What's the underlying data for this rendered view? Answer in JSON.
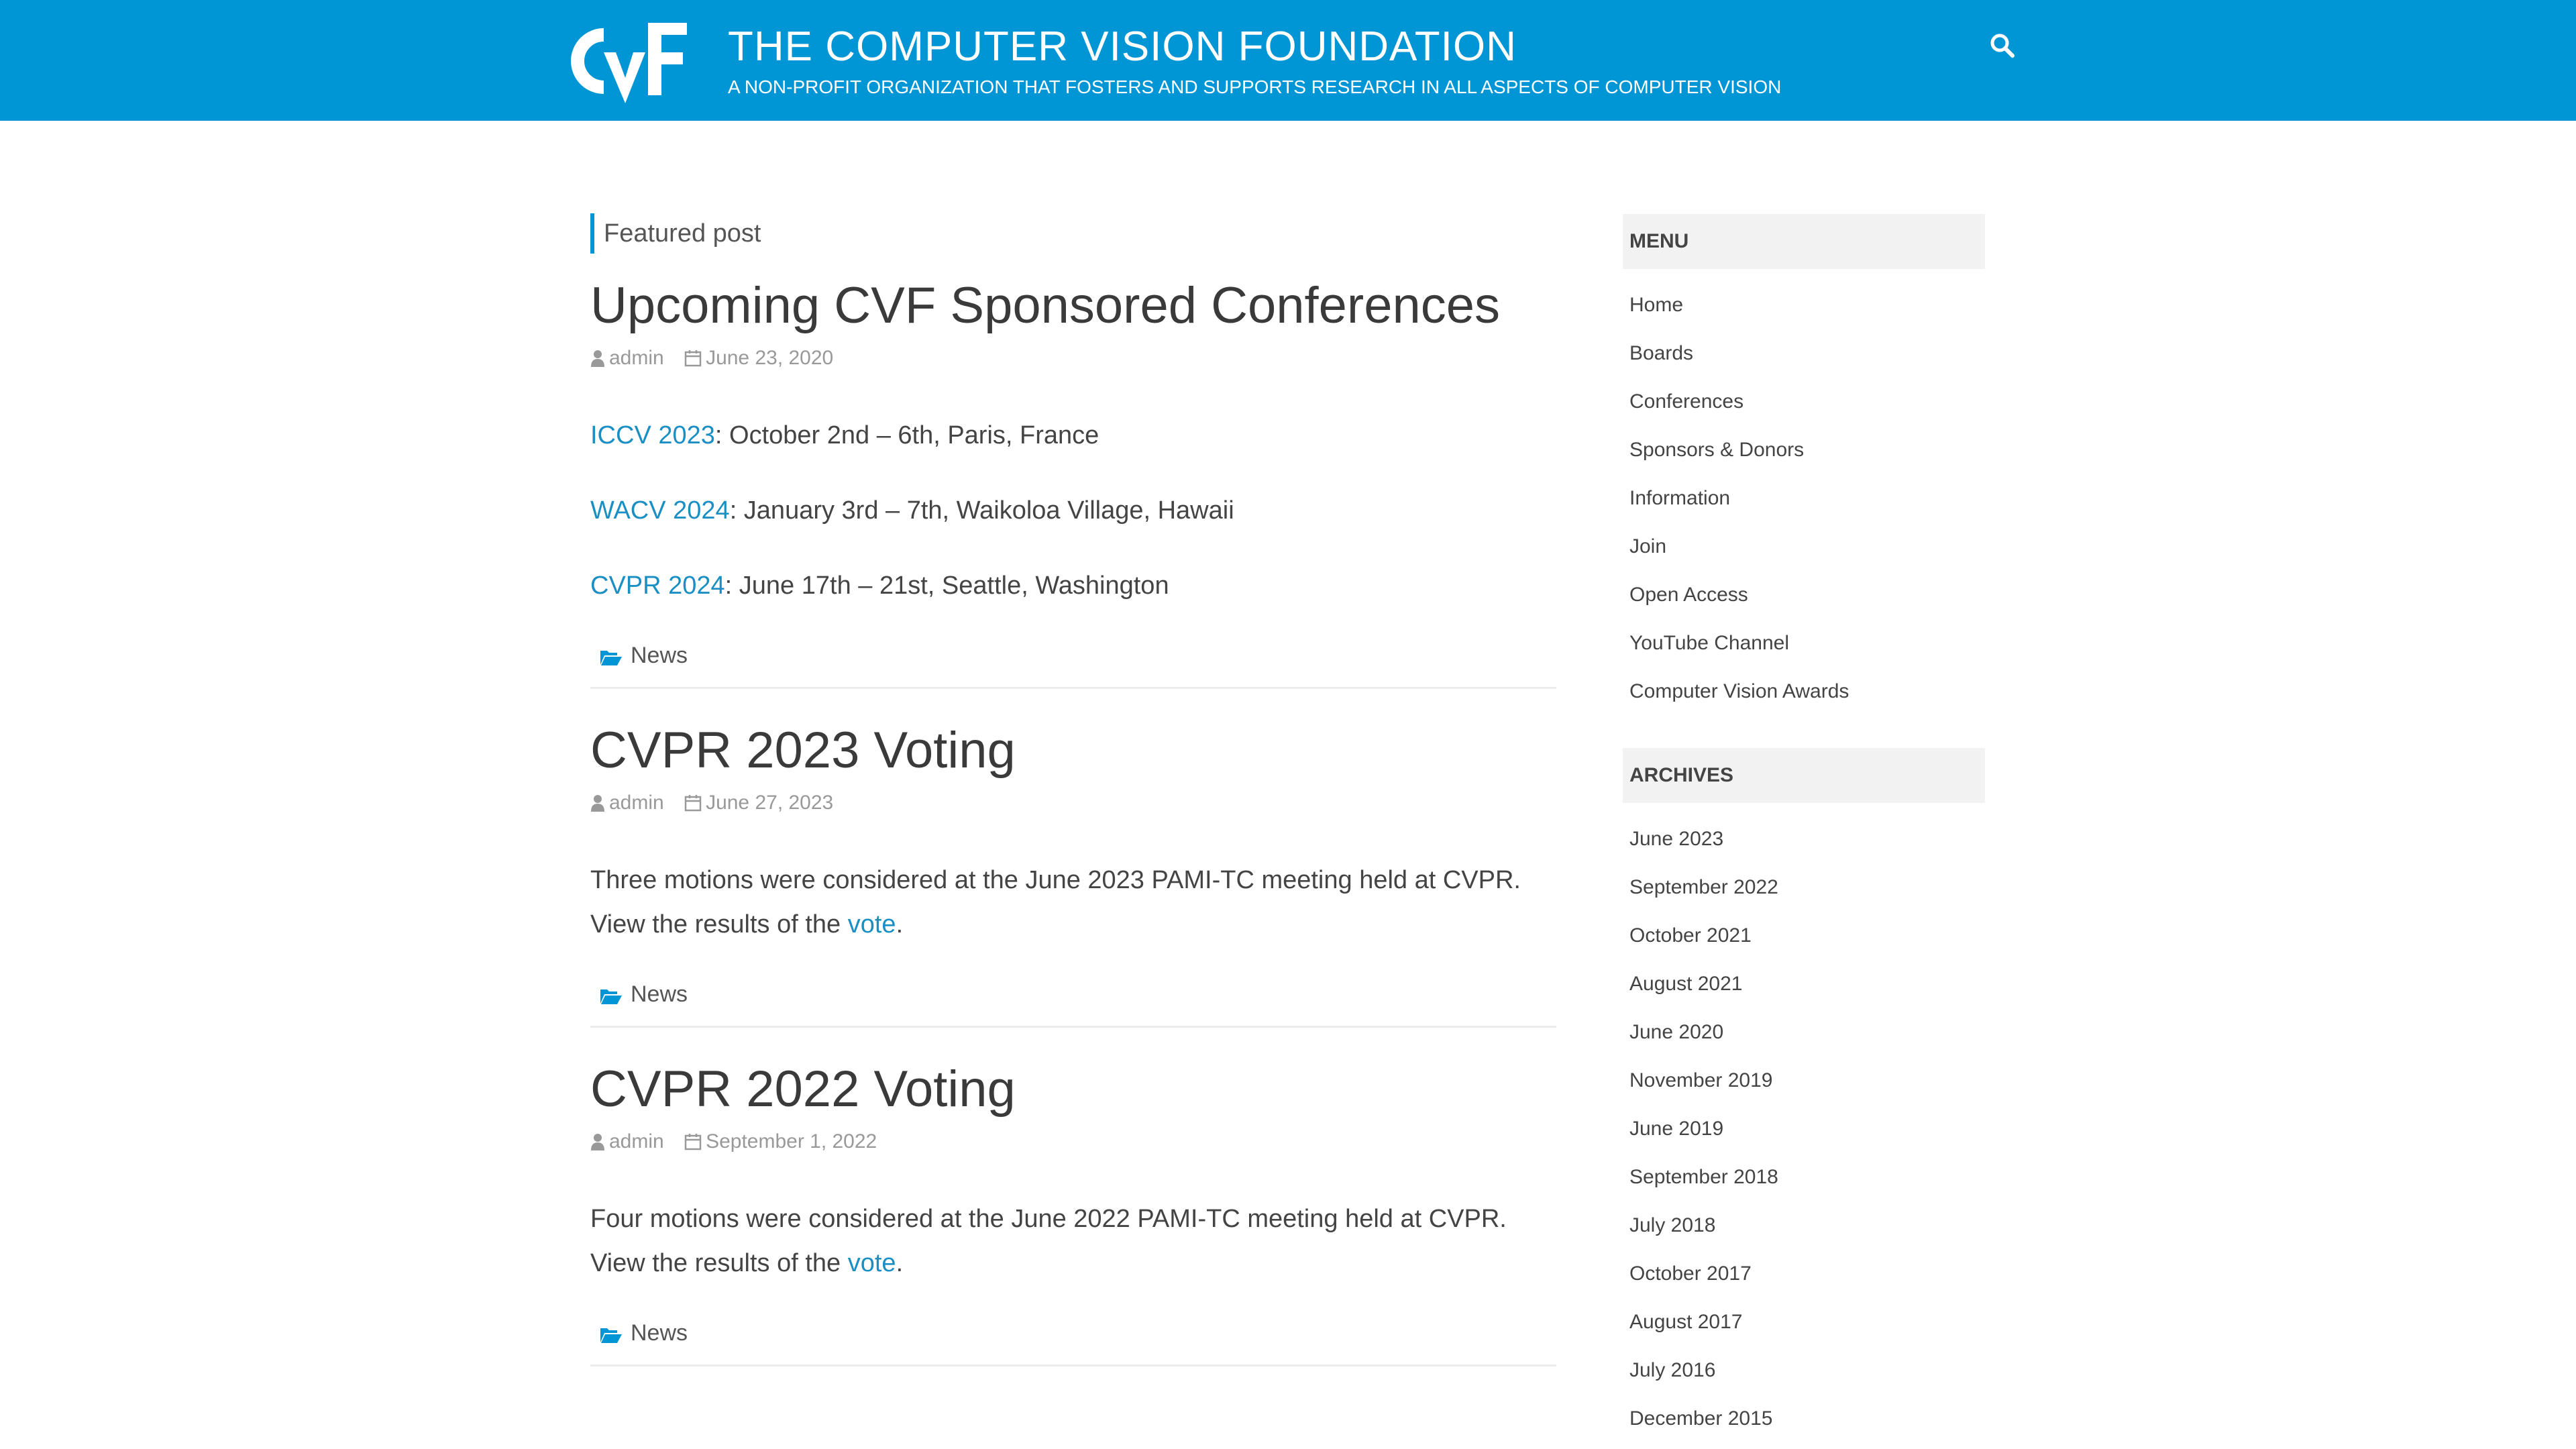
{
  "header": {
    "title": "THE COMPUTER VISION FOUNDATION",
    "tagline": "A NON-PROFIT ORGANIZATION THAT FOSTERS AND SUPPORTS RESEARCH IN ALL ASPECTS OF COMPUTER VISION",
    "logo_text": "CVF",
    "search_icon": "search-icon",
    "brand_color": "#0095d4"
  },
  "featured_label": "Featured post",
  "posts": [
    {
      "title": "Upcoming CVF Sponsored Conferences",
      "author": "admin",
      "date": "June 23, 2020",
      "conferences": [
        {
          "link": "ICCV 2023",
          "text": ": October 2nd – 6th, Paris, France"
        },
        {
          "link": "WACV 2024",
          "text": ": January 3rd – 7th, Waikoloa Village, Hawaii"
        },
        {
          "link": "CVPR 2024",
          "text": ": June 17th – 21st, Seattle, Washington"
        }
      ],
      "category": "News"
    },
    {
      "title": "CVPR 2023 Voting",
      "author": "admin",
      "date": "June 27, 2023",
      "body_before": "Three motions were considered at the June 2023 PAMI-TC meeting held at CVPR. View the results of the ",
      "body_link": "vote",
      "body_after": ".",
      "category": "News"
    },
    {
      "title": "CVPR 2022 Voting",
      "author": "admin",
      "date": "September 1, 2022",
      "body_before": "Four motions were considered at the June 2022 PAMI-TC meeting held at CVPR. View the results of the ",
      "body_link": "vote",
      "body_after": ".",
      "category": "News"
    }
  ],
  "sidebar": {
    "menu": {
      "title": "MENU",
      "items": [
        "Home",
        "Boards",
        "Conferences",
        "Sponsors & Donors",
        "Information",
        "Join",
        "Open Access",
        "YouTube Channel",
        "Computer Vision Awards"
      ]
    },
    "archives": {
      "title": "ARCHIVES",
      "items": [
        "June 2023",
        "September 2022",
        "October 2021",
        "August 2021",
        "June 2020",
        "November 2019",
        "June 2019",
        "September 2018",
        "July 2018",
        "October 2017",
        "August 2017",
        "July 2016",
        "December 2015"
      ]
    }
  }
}
